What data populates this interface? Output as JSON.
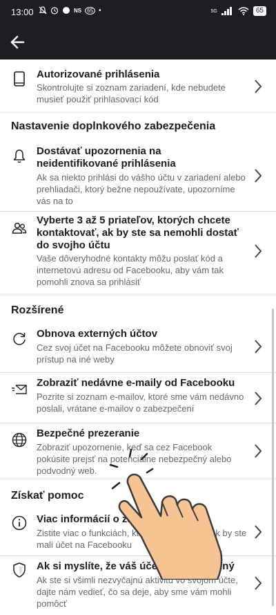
{
  "status_bar": {
    "time": "13:00",
    "ns_label": "NS",
    "badge_label": "65",
    "network_label": "5G",
    "battery_level": "65"
  },
  "colors": {
    "bar": "#1c1e21",
    "background": "#f0f2f5",
    "muted_text": "#65676b"
  },
  "items": [
    {
      "icon": "phone-icon",
      "title": "Autorizované prihlásenia",
      "description": "Skontrolujte si zoznam zariadení, kde nebudete musieť použiť prihlasovací kód"
    },
    {
      "icon": "bell-icon",
      "title": "Dostávať upozornenia na neidentifikované prihlásenia",
      "description": "Ak sa niekto prihlási do vášho účtu v zariadení alebo prehliadači, ktorý bežne nepoužívate, upozorníme vás na to"
    },
    {
      "icon": "friends-icon",
      "title": "Vyberte 3 až 5 priateľov, ktorých chcete kontaktovať, ak by ste sa nemohli dostať do svojho účtu",
      "description": "Vaše dôveryhodné kontakty môžu poslať kód a internetovú adresu od Facebooku, aby vám tak pomohli znova sa prihlásiť"
    },
    {
      "icon": "refresh-icon",
      "title": "Obnova externých účtov",
      "description": "Cez svoj účet na Facebooku môžete obnoviť svoj prístup na iné weby"
    },
    {
      "icon": "email-icon",
      "title": "Zobraziť nedávne e-maily od Facebooku",
      "description": "Pozrite si zoznam e-mailov, ktoré sme vám nedávno poslali, vrátane e-mailov o zabezpečení"
    },
    {
      "icon": "globe-icon",
      "title": "Bezpečné prezeranie",
      "description": "Zobraziť upozornenie, keď sa cez Facebook pokúsite prejsť na potenciálne nebezpečný alebo podvodný web."
    },
    {
      "icon": "info-icon",
      "title": "Viac informácií o zabezpečení",
      "description": "Zistite viac o funkciách, ktoré vám pomôžu, ak by ste mali účet na Facebooku"
    },
    {
      "icon": "shield-icon",
      "title": "Ak si myslíte, že váš účet bol prelomený",
      "description": "Ak ste si všimli nezvyčajnú aktivitu vo svojom účte, dajte nám vedieť, čo sa deje, aby sme vám mohli pomôcť"
    }
  ],
  "sections": {
    "extra_security": "Nastavenie doplnkového zabezpečenia",
    "advanced": "Rozšírené",
    "get_help": "Získať pomoc"
  }
}
